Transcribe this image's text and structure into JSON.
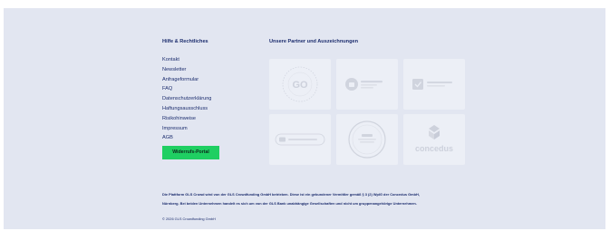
{
  "left_column": {
    "heading": "Hilfe & Rechtliches",
    "links": [
      "Kontakt",
      "Newsletter",
      "Anfrageformular",
      "FAQ",
      "Datenschutzerklärung",
      "Haftungsausschluss",
      "Risikohinweise",
      "Impressum",
      "AGB"
    ],
    "cta_label": "Widerrufs-Portal"
  },
  "right_column": {
    "heading": "Unsere Partner und Auszeichnungen",
    "partners": [
      {
        "icon": "go-award-seal-icon",
        "text": "GO"
      },
      {
        "icon": "secure-ssl-badge-icon",
        "text": ""
      },
      {
        "icon": "crowdfunding-check-badge-icon",
        "text": ""
      },
      {
        "icon": "wallet-badge-icon",
        "text": ""
      },
      {
        "icon": "circle-seal-icon",
        "text": ""
      },
      {
        "icon": "concedus-logo-icon",
        "text": "concedus"
      }
    ]
  },
  "disclaimer": {
    "line1": "Die Plattform GLS Crowd wird von der GLS Crowdfunding GmbH betrieben. Diese ist ein gebundener Vermittler gemäß § 3 (2) WpIG der Concedus GmbH,",
    "line2": "Nürnberg. Bei beiden Unternehmen handelt es sich um von der GLS Bank unabhängige Gesellschaften und nicht um gruppenangehörige Unternehmen."
  },
  "copyright": "© 2026 GLS Crowdfunding GmbH",
  "colors": {
    "background": "#e2e6f1",
    "text": "#1c2d6e",
    "cta": "#1fcf62",
    "card": "#eceff6"
  }
}
